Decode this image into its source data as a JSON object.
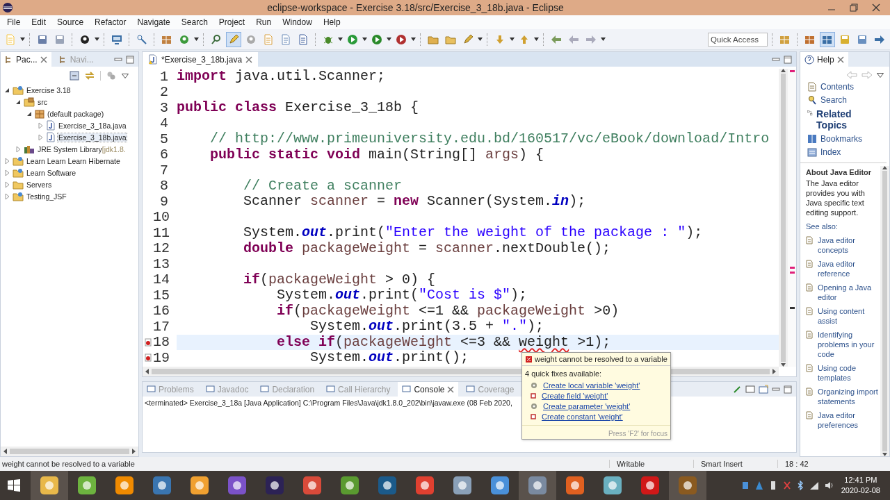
{
  "window": {
    "title": "eclipse-workspace - Exercise 3.18/src/Exercise_3_18b.java - Eclipse"
  },
  "menu": [
    "File",
    "Edit",
    "Source",
    "Refactor",
    "Navigate",
    "Search",
    "Project",
    "Run",
    "Window",
    "Help"
  ],
  "quick_access": {
    "placeholder": "Quick Access"
  },
  "left_panel": {
    "tabs": [
      {
        "label": "Pac...",
        "selected": true
      },
      {
        "label": "Navi...",
        "selected": false
      }
    ],
    "tree": [
      {
        "label": "Exercise 3.18",
        "kind": "project",
        "expanded": true,
        "selected": false,
        "children": [
          {
            "label": "src",
            "kind": "source",
            "expanded": true,
            "selected": false,
            "children": [
              {
                "label": "(default package)",
                "kind": "package",
                "expanded": true,
                "selected": false,
                "children": [
                  {
                    "label": "Exercise_3_18a.java",
                    "kind": "file",
                    "expanded": false,
                    "selected": false
                  },
                  {
                    "label": "Exercise_3_18b.java",
                    "kind": "file",
                    "expanded": false,
                    "selected": true
                  }
                ]
              }
            ]
          },
          {
            "label": "JRE System Library",
            "suffix": "[jdk1.8.",
            "kind": "library",
            "expanded": false,
            "selected": false
          }
        ]
      },
      {
        "label": "Learn Learn Learn Hibernate",
        "kind": "project",
        "expanded": false,
        "selected": false
      },
      {
        "label": "Learn Software",
        "kind": "project",
        "expanded": false,
        "selected": false
      },
      {
        "label": "Servers",
        "kind": "folder",
        "expanded": false,
        "selected": false
      },
      {
        "label": "Testing_JSF",
        "kind": "project",
        "expanded": false,
        "selected": false
      }
    ]
  },
  "editor": {
    "tab": {
      "label": "*Exercise_3_18b.java",
      "selected": true
    },
    "lines": [
      {
        "number": "1",
        "error": false,
        "current": false,
        "tokens": [
          {
            "kind": "keyword",
            "text": "import"
          },
          {
            "kind": "plain",
            "text": " java.util.Scanner;"
          }
        ]
      },
      {
        "number": "2",
        "error": false,
        "current": false
      },
      {
        "number": "3",
        "error": false,
        "current": false,
        "tokens": [
          {
            "kind": "keyword",
            "text": "public class"
          },
          {
            "kind": "plain",
            "text": " Exercise_3_18b {"
          }
        ]
      },
      {
        "number": "4",
        "error": false,
        "current": false
      },
      {
        "number": "5",
        "error": false,
        "current": false,
        "tokens": [
          {
            "kind": "comment",
            "text": "    // http://www.primeuniversity.edu.bd/160517/vc/eBook/download/Intro"
          }
        ]
      },
      {
        "number": "6",
        "error": false,
        "current": false,
        "tokens": [
          {
            "kind": "keyword",
            "text": "    public static void"
          },
          {
            "kind": "plain",
            "text": " main(String[] "
          },
          {
            "kind": "local",
            "text": "args"
          },
          {
            "kind": "plain",
            "text": ") {"
          }
        ]
      },
      {
        "number": "7",
        "error": false,
        "current": false
      },
      {
        "number": "8",
        "error": false,
        "current": false,
        "tokens": [
          {
            "kind": "comment",
            "text": "        // Create a scanner"
          }
        ]
      },
      {
        "number": "9",
        "error": false,
        "current": false,
        "tokens": [
          {
            "kind": "plain",
            "text": "        Scanner "
          },
          {
            "kind": "local",
            "text": "scanner"
          },
          {
            "kind": "plain",
            "text": " = "
          },
          {
            "kind": "keyword",
            "text": "new"
          },
          {
            "kind": "plain",
            "text": " Scanner(System."
          },
          {
            "kind": "field",
            "text": "in"
          },
          {
            "kind": "plain",
            "text": ");"
          }
        ]
      },
      {
        "number": "10",
        "error": false,
        "current": false
      },
      {
        "number": "11",
        "error": false,
        "current": false,
        "tokens": [
          {
            "kind": "plain",
            "text": "        System."
          },
          {
            "kind": "field",
            "text": "out"
          },
          {
            "kind": "plain",
            "text": ".print("
          },
          {
            "kind": "string",
            "text": "\"Enter the weight of the package : \""
          },
          {
            "kind": "plain",
            "text": ");"
          }
        ]
      },
      {
        "number": "12",
        "error": false,
        "current": false,
        "tokens": [
          {
            "kind": "keyword",
            "text": "        double"
          },
          {
            "kind": "local",
            "text": " packageWeight"
          },
          {
            "kind": "plain",
            "text": " = "
          },
          {
            "kind": "local",
            "text": "scanner"
          },
          {
            "kind": "plain",
            "text": ".nextDouble();"
          }
        ]
      },
      {
        "number": "13",
        "error": false,
        "current": false
      },
      {
        "number": "14",
        "error": false,
        "current": false,
        "tokens": [
          {
            "kind": "keyword",
            "text": "        if"
          },
          {
            "kind": "plain",
            "text": "("
          },
          {
            "kind": "local",
            "text": "packageWeight"
          },
          {
            "kind": "plain",
            "text": " > 0) {"
          }
        ]
      },
      {
        "number": "15",
        "error": false,
        "current": false,
        "tokens": [
          {
            "kind": "plain",
            "text": "            System."
          },
          {
            "kind": "field",
            "text": "out"
          },
          {
            "kind": "plain",
            "text": ".print("
          },
          {
            "kind": "string",
            "text": "\"Cost is $\""
          },
          {
            "kind": "plain",
            "text": ");"
          }
        ]
      },
      {
        "number": "16",
        "error": false,
        "current": false,
        "tokens": [
          {
            "kind": "keyword",
            "text": "            if"
          },
          {
            "kind": "plain",
            "text": "("
          },
          {
            "kind": "local",
            "text": "packageWeight"
          },
          {
            "kind": "plain",
            "text": " <=1 && "
          },
          {
            "kind": "local",
            "text": "packageWeight"
          },
          {
            "kind": "plain",
            "text": " >0)"
          }
        ]
      },
      {
        "number": "17",
        "error": false,
        "current": false,
        "tokens": [
          {
            "kind": "plain",
            "text": "                System."
          },
          {
            "kind": "field",
            "text": "out"
          },
          {
            "kind": "plain",
            "text": ".print(3.5 + "
          },
          {
            "kind": "string",
            "text": "\".\""
          },
          {
            "kind": "plain",
            "text": ");"
          }
        ]
      },
      {
        "number": "18",
        "error": true,
        "current": true,
        "tokens": [
          {
            "kind": "keyword",
            "text": "            else if"
          },
          {
            "kind": "plain",
            "text": "("
          },
          {
            "kind": "local",
            "text": "packageWeight"
          },
          {
            "kind": "plain",
            "text": " <=3 && "
          },
          {
            "kind": "error",
            "text": "weight"
          },
          {
            "kind": "plain",
            "text": " >1);"
          }
        ]
      },
      {
        "number": "19",
        "error": true,
        "current": false,
        "tokens": [
          {
            "kind": "plain",
            "text": "                System."
          },
          {
            "kind": "field",
            "text": "out"
          },
          {
            "kind": "plain",
            "text": ".print();"
          }
        ]
      }
    ]
  },
  "bottom_panel": {
    "tabs": [
      {
        "label": "Problems",
        "selected": false
      },
      {
        "label": "Javadoc",
        "selected": false
      },
      {
        "label": "Declaration",
        "selected": false
      },
      {
        "label": "Call Hierarchy",
        "selected": false
      },
      {
        "label": "Console",
        "selected": true
      },
      {
        "label": "Coverage",
        "selected": false
      }
    ],
    "console_header": "<terminated> Exercise_3_18a [Java Application] C:\\Program Files\\Java\\jdk1.8.0_202\\bin\\javaw.exe (08 Feb 2020,"
  },
  "quick_fix": {
    "title": "weight cannot be resolved to a variable",
    "subtitle": "4 quick fixes available:",
    "fixes": [
      {
        "label": "Create local variable 'weight'",
        "kind": "local"
      },
      {
        "label": "Create field 'weight'",
        "kind": "field"
      },
      {
        "label": "Create parameter 'weight'",
        "kind": "parameter"
      },
      {
        "label": "Create constant 'weight'",
        "kind": "constant"
      }
    ],
    "footer": "Press 'F2' for focus"
  },
  "help": {
    "tab": "Help",
    "nav": [
      {
        "label": "Contents",
        "kind": "contents",
        "selected": false
      },
      {
        "label": "Search",
        "kind": "search",
        "selected": false
      },
      {
        "label": "Related Topics",
        "kind": "related",
        "selected": true
      },
      {
        "label": "Bookmarks",
        "kind": "bookmarks",
        "selected": false
      },
      {
        "label": "Index",
        "kind": "index",
        "selected": false
      }
    ],
    "heading": "About Java Editor",
    "text": "The Java editor provides you with Java specific text editing support.",
    "see_also": "See also:",
    "links": [
      "Java editor concepts",
      "Java editor reference",
      "Opening a Java editor",
      "Using content assist",
      "Identifying problems in your code",
      "Using code templates",
      "Organizing import statements",
      "Java editor preferences"
    ]
  },
  "status_bar": {
    "message": "weight cannot be resolved to a variable",
    "mode": "Writable",
    "insert": "Smart Insert",
    "position": "18 : 42"
  },
  "taskbar": {
    "apps": [
      {
        "color": "#e8b84a",
        "active": true
      },
      {
        "color": "#6db33f",
        "active": false
      },
      {
        "color": "#f08a00",
        "active": false
      },
      {
        "color": "#3a75b0",
        "active": false
      },
      {
        "color": "#f0a030",
        "active": false
      },
      {
        "color": "#7b52c8",
        "active": false
      },
      {
        "color": "#2c2255",
        "active": false
      },
      {
        "color": "#d84a3a",
        "active": false
      },
      {
        "color": "#5a9a30",
        "active": false
      },
      {
        "color": "#1b5a8a",
        "active": false
      },
      {
        "color": "#e04030",
        "active": false
      },
      {
        "color": "#8aa0b8",
        "active": false
      },
      {
        "color": "#4a90d9",
        "active": false
      },
      {
        "color": "#7a8aa0",
        "active": true
      },
      {
        "color": "#e06020",
        "active": false
      },
      {
        "color": "#6ab0c0",
        "active": false
      },
      {
        "color": "#d01818",
        "active": false
      },
      {
        "color": "#8a5a20",
        "active": true
      }
    ],
    "time": "12:41 PM",
    "date": "2020-02-08"
  }
}
